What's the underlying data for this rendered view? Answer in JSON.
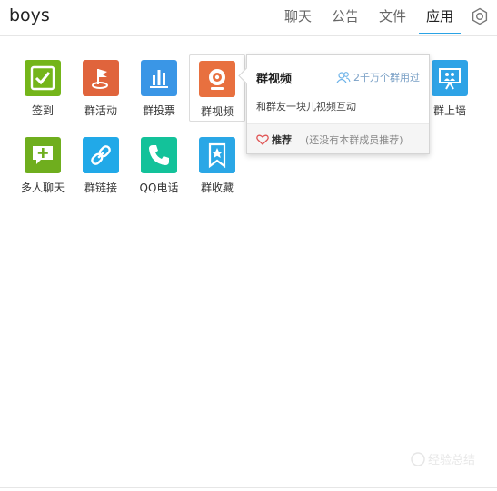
{
  "header": {
    "title": "boys",
    "tabs": [
      {
        "label": "聊天"
      },
      {
        "label": "公告"
      },
      {
        "label": "文件"
      },
      {
        "label": "应用"
      }
    ],
    "active_tab": "应用",
    "settings_icon": "gear-icon"
  },
  "apps": [
    {
      "label": "签到",
      "color": "#74b51a",
      "icon": "checkbox-icon"
    },
    {
      "label": "群活动",
      "color": "#e0643c",
      "icon": "flag-icon"
    },
    {
      "label": "群投票",
      "color": "#3a96e6",
      "icon": "bar-chart-icon"
    },
    {
      "label": "群视频",
      "color": "#e8703f",
      "icon": "webcam-icon"
    },
    {
      "label": "群上墙",
      "color": "#2ea3e6",
      "icon": "presentation-icon"
    },
    {
      "label": "多人聊天",
      "color": "#6fae1e",
      "icon": "chat-plus-icon"
    },
    {
      "label": "群链接",
      "color": "#21a9e8",
      "icon": "link-icon"
    },
    {
      "label": "QQ电话",
      "color": "#13c29a",
      "icon": "phone-icon"
    },
    {
      "label": "群收藏",
      "color": "#2aa7e6",
      "icon": "bookmark-star-icon"
    }
  ],
  "popup": {
    "title": "群视频",
    "count_text": "2千万个群用过",
    "description": "和群友一块儿视频互动",
    "recommend_label": "推荐",
    "recommend_note": "(还没有本群成员推荐)"
  },
  "watermark": {
    "text": "经验总结"
  }
}
